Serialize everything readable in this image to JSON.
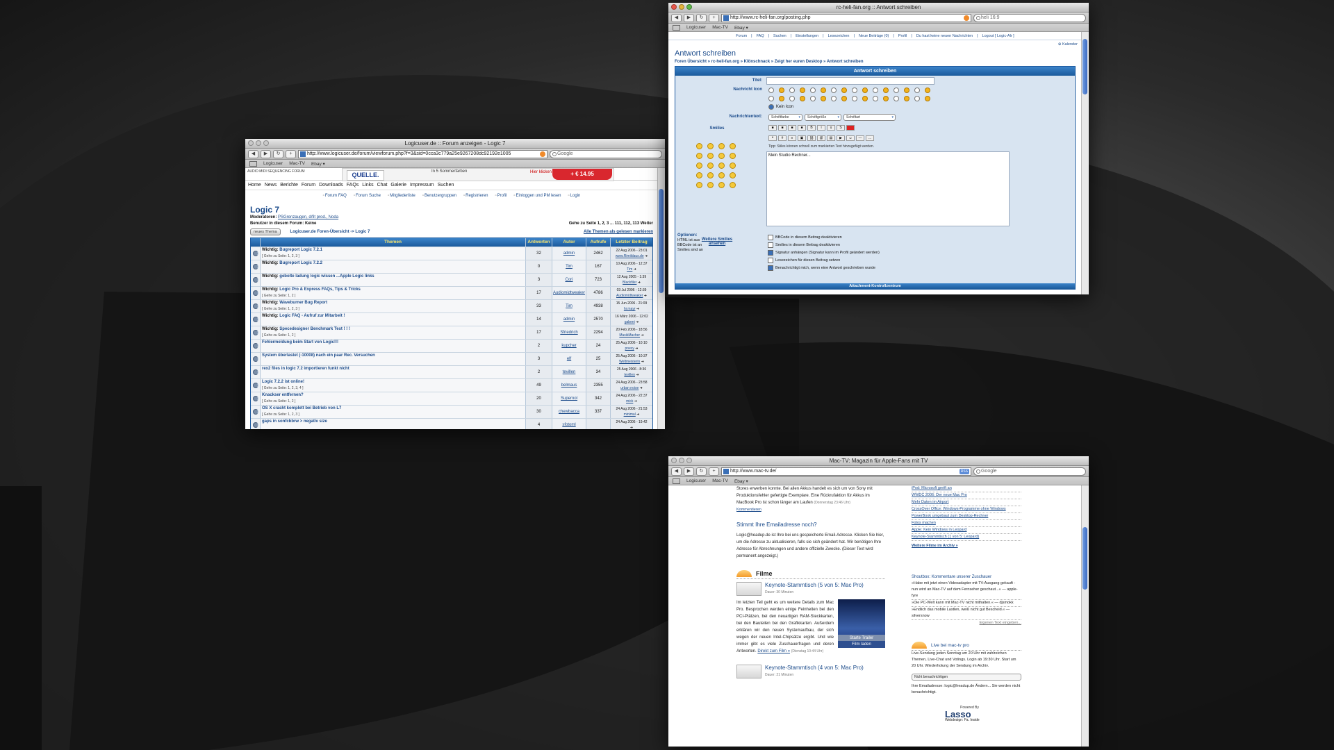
{
  "windows": {
    "forum": {
      "title": "Logicuser.de :: Forum anzeigen - Logic 7",
      "url": "http://www.logicuser.de/forum/viewforum.php?f=3&sid=0cca3c779a25e9267208dc92192e1005",
      "search": "Google",
      "bookmarks": [
        "Logicuser",
        "Mac-TV",
        "Ebay ▾"
      ],
      "logo": "AUDIO MIDI SEQUENCING FORUM",
      "banner": {
        "brand": "QUELLE.",
        "mid": "In 5 Sommerfarben",
        "click": "Hier klicken",
        "price": "+ € 14.95"
      },
      "nav": [
        "Home",
        "News",
        "Berichte",
        "Forum",
        "Downloads",
        "FAQs",
        "Links",
        "Chat",
        "Galerie",
        "Impressum",
        "Suchen"
      ],
      "subnav": [
        "Forum FAQ",
        "Forum Suche",
        "Mitgliederliste",
        "Benutzergruppen",
        "Registrieren",
        "Profil",
        "Einloggen und PM lesen",
        "Login"
      ],
      "forum_title": "Logic 7",
      "moderators_label": "Moderatoren:",
      "moderators": "PSGrenzaugen, d/fit prod., Noda",
      "users_label": "Benutzer in diesem Forum: Keine",
      "pages": "Gehe zu Seite 1, 2, 3 ... 111, 112, 113  Weiter",
      "new_button": "neues Thema",
      "breadcrumb": "Logicuser.de Foren-Übersicht -> Logic 7",
      "mark_read": "Alle Themen als gelesen markieren",
      "headers": [
        "Themen",
        "Antworten",
        "Autor",
        "Aufrufe",
        "Letzter Beitrag"
      ],
      "rows": [
        {
          "prefix": "Wichtig:",
          "title": "Bugreport Logic 7.2.1",
          "pages": "[ Gehe zu Seite: 1, 2, 3 ]",
          "replies": "32",
          "author": "admin",
          "views": "2462",
          "last": "22 Aug 2006 - 23:01",
          "last_by": "www.Rimildaus.de"
        },
        {
          "prefix": "Wichtig:",
          "title": "Bugreport Logic 7.2.2",
          "pages": "",
          "replies": "0",
          "author": "Tim",
          "views": "167",
          "last": "10 Aug 2006 - 12:37",
          "last_by": "Tim"
        },
        {
          "prefix": "Wichtig:",
          "title": "gebolte ladung logic wissen ...Apple Logic links",
          "pages": "",
          "replies": "3",
          "author": "Cori",
          "views": "723",
          "last": "12 Aug 2005 - 1:39",
          "last_by": "Blackfiler"
        },
        {
          "prefix": "Wichtig:",
          "title": "Logic Pro & Express FAQs, Tips & Tricks",
          "pages": "[ Gehe zu Seite: 1, 2 ]",
          "replies": "17",
          "author": "Audiomidtweaker",
          "views": "4786",
          "last": "03 Jul 2006 - 12:39",
          "last_by": "Audiomidtweaker"
        },
        {
          "prefix": "Wichtig:",
          "title": "Waveburner Bug Report",
          "pages": "[ Gehe zu Seite: 1, 2, 3 ]",
          "replies": "33",
          "author": "Tim",
          "views": "4938",
          "last": "15 Jun 2006 - 21:09",
          "last_by": "hr.mayr"
        },
        {
          "prefix": "Wichtig:",
          "title": "Logic FAQ - Aufruf zur Mitarbeit !",
          "pages": "",
          "replies": "14",
          "author": "admin",
          "views": "2570",
          "last": "16 März 2006 - 12:02",
          "last_by": "gabeni"
        },
        {
          "prefix": "Wichtig:",
          "title": "Specedesigner Benchmark Test ! ! !",
          "pages": "[ Gehe zu Seite: 1, 2 ]",
          "replies": "17",
          "author": "Sfriedrich",
          "views": "2294",
          "last": "20 Feb 2006 - 18:56",
          "last_by": "MusikMacher"
        },
        {
          "prefix": "",
          "title": "Fehlermeldung beim Start von Logic!!!",
          "pages": "",
          "replies": "2",
          "author": "kupcher",
          "views": "24",
          "last": "25 Aug 2006 - 10:10",
          "last_by": "poesy"
        },
        {
          "prefix": "",
          "title": "System überlastet (-10008) nach ein paar Rec. Versuchen",
          "pages": "",
          "replies": "3",
          "author": "elf",
          "views": "25",
          "last": "25 Aug 2006 - 10:37",
          "last_by": "Weltmeisterin"
        },
        {
          "prefix": "",
          "title": "rex2 files in logic 7.2 importieren funkt nicht",
          "pages": "",
          "replies": "2",
          "author": "tevillen",
          "views": "34",
          "last": "25 Aug 2006 - 8:36",
          "last_by": "tevillen"
        },
        {
          "prefix": "",
          "title": "Logic 7.2.2 ist online!",
          "pages": "[ Gehe zu Seite: 1, 2, 3, 4 ]",
          "replies": "49",
          "author": "belmaus",
          "views": "2355",
          "last": "24 Aug 2006 - 23:58",
          "last_by": "urban noise"
        },
        {
          "prefix": "",
          "title": "Knackser entfernen?",
          "pages": "[ Gehe zu Seite: 1, 2 ]",
          "replies": "20",
          "author": "Supernol",
          "views": "342",
          "last": "24 Aug 2006 - 22:37",
          "last_by": "mick"
        },
        {
          "prefix": "",
          "title": "OS X crasht komplett bei Betrieb von L7",
          "pages": "[ Gehe zu Seite: 1, 2, 3 ]",
          "replies": "30",
          "author": "chewbacca",
          "views": "337",
          "last": "24 Aug 2006 - 21:53",
          "last_by": "minimal"
        },
        {
          "prefix": "",
          "title": "gaps in sonfcbbrw > negativ size",
          "pages": "",
          "replies": "4",
          "author": "sfotoml",
          "views": "",
          "last": "24 Aug 2006 - 19:42",
          "last_by": ""
        }
      ]
    },
    "heli": {
      "title": "rc-heli-fan.org :: Antwort schreiben",
      "url": "http://www.rc-heli-fan.org/posting.php",
      "search": "heli 16:9",
      "bookmarks": [
        "Logicuser",
        "Mac-TV",
        "Ebay ▾"
      ],
      "tabs": [
        "Forum",
        "FAQ",
        "Suchen",
        "Einstellungen",
        "Lesezeichen",
        "Neue Beiträge (0)",
        "Profil",
        "Du hast keine neuen Nachrichten",
        "Logout [ Logic-Alr ]"
      ],
      "calendar": "Kalender",
      "page_title": "Antwort schreiben",
      "crumbs": "Foren Übersicht » rc-heli-fan.org » Klönschnack » Zeigt her euren Desktop » Antwort schreiben",
      "panel_head": "Antwort schreiben",
      "label_title": "Titel:",
      "label_icon": "Nachricht Icon",
      "no_icon": "Kein Icon",
      "label_text": "Nachrichtentext:",
      "selects": [
        "Schriftfarbe",
        "Schriftgröße",
        "Schriftart"
      ],
      "smilies_label": "Smilies",
      "more_smilies": "Weitere Smilies ansehen",
      "tip": "Tipp: Stiles können schnell zum markierten Text hinzugefügt werden.",
      "message": "Mein Studio Rechner...",
      "options_label": "Optionen:",
      "options_meta": [
        "HTML ist aus",
        "BBCode ist an",
        "Smilies sind an"
      ],
      "options": [
        {
          "label": "BBCode in diesem Beitrag deaktivieren",
          "checked": false
        },
        {
          "label": "Smilies in diesem Beitrag deaktivieren",
          "checked": false
        },
        {
          "label": "Signatur anhängen (Signatur kann im Profil geändert werden)",
          "checked": true
        },
        {
          "label": "Lesezeichen für diesen Beitrag setzen",
          "checked": false
        },
        {
          "label": "Benachrichtigt mich, wenn eine Antwort geschrieben wurde",
          "checked": true
        }
      ],
      "footer": "Attachment-Kontrollzentrum"
    },
    "mactv": {
      "title": "Mac-TV: Magazin für Apple-Fans mit TV",
      "url": "http://www.mac-tv.de/",
      "search": "Google",
      "bookmarks": [
        "Logicuser",
        "Mac-TV",
        "Ebay ▾"
      ],
      "intro": "Stores erwerben konnte. Bei allen Akkus handelt es sich um von Sony mit Produktionsfehler gefertigte Exemplare. Eine Rückrufaktion für Akkus im MacBook Pro ist schon länger am Laufen",
      "intro_date": "(Donnerstag 23:46 Uhr)",
      "comments": "Kommentieren",
      "email_head": "Stimmt Ihre Emailadresse noch?",
      "email_text": "Logic@headup.de ist Ihre bei uns gespeicherte Email-Adresse. Klicken Sie hier, um die Adresse zu aktualisieren, falls sie sich geändert hat. Wir benötigen Ihre Adresse für Abrechnungen und andere offizielle Zwecke. (Dieser Text wird permanent angezeigt.)",
      "films_head": "Filme",
      "film1_title": "Keynote-Stammtisch (5 von 5: Mac Pro)",
      "film1_dur": "Dauer: 30 Minuten",
      "film1_text": "Im letzten Teil geht es um weitere Details zum Mac Pro. Besprochen werden einige Feinheiten bei den PCI-Plätzen, bei den neuartigen RAM-Steckkarten, bei den Bauteilen bei den Grafikkarten. Außerdem erklären wir den neuen Systemaufbau, der sich wegen der neuen Intel-Chipsätze ergibt. Und wie immer gibt es viele Zuschauerfragen und deren Antworten.",
      "film1_link": "Direkt zum Film »",
      "film1_date": "(Dienstag 10:44 Uhr)",
      "film1_btn1": "Starte Trailer",
      "film1_btn2": "Film laden",
      "film2_title": "Keynote-Stammtisch (4 von 5: Mac Pro)",
      "film2_dur": "Dauer: 21 Minuten",
      "right_list": [
        "iPod: Microsoft greift an",
        "WWDC 2006: Der neue Mac Pro",
        "Mehr Daten im Airport",
        "CrossOver Office: Windows-Programme ohne Windows",
        "PowerBook umgebaut zum Desktop-Rechner",
        "Fotos machen",
        "Apple: Kein Windows in Leopard",
        "Keynote-Stammtisch (1 von 5: Leopard)"
      ],
      "more_films": "Weitere Filme im Archiv »",
      "shoutbox_head": "Shoutbox: Kommentare unserer Zuschauer",
      "shoutbox": [
        "»Habe mit jetzt einen Videoadapter mit TV-Ausgang gekauft - nun wird an Mac-TV auf dem Fernseher geschaut...« — apple-fyre",
        "»Die PC-Welt kann mit Mac-TV nicht mithalten.« — djsmokk",
        "»Endlich das mobile Lastlen, weiß nicht gut Bescheid.« — silversnow"
      ],
      "own_text": "Eigenen Text eingeben...",
      "live_head": "Live bei mac-tv pro",
      "live_text": "Live-Sendung jeden Sonntag um 20 Uhr mit zahlreichen Themen, Live-Chat und Votings. Login ab 19:30 Uhr. Start um 20 Uhr. Wiederholung der Sendung im Archiv.",
      "notify_select": "Nicht benachrichtigen",
      "notify_text": "Ihre Emailadresse: logic@headup.de  Ändern... Sie werden nicht benachrichtigt.",
      "powered": "Powered By",
      "lasso": "Lasso",
      "webdesign": "Webdesign: Fa. Inside"
    }
  }
}
